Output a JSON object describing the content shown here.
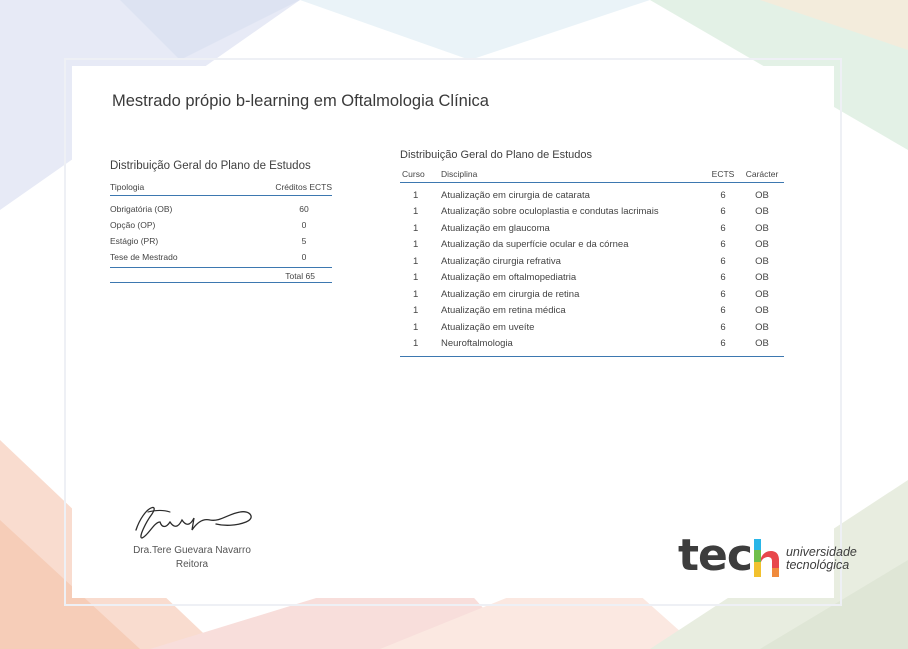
{
  "document": {
    "title": "Mestrado própio b-learning em Oftalmologia Clínica"
  },
  "summary": {
    "title": "Distribuição Geral do Plano de Estudos",
    "headers": {
      "type": "Tipologia",
      "credits": "Créditos ECTS"
    },
    "rows": [
      {
        "type": "Obrigatória (OB)",
        "credits": "60"
      },
      {
        "type": "Opção (OP)",
        "credits": "0"
      },
      {
        "type": "Estágio (PR)",
        "credits": "5"
      },
      {
        "type": "Tese de Mestrado",
        "credits": "0"
      }
    ],
    "total": "Total 65"
  },
  "curriculum": {
    "title": "Distribuição Geral do Plano de Estudos",
    "headers": {
      "course": "Curso",
      "subject": "Disciplina",
      "ects": "ECTS",
      "type": "Carácter"
    },
    "rows": [
      {
        "course": "1",
        "subject": "Atualização em cirurgia de catarata",
        "ects": "6",
        "type": "OB"
      },
      {
        "course": "1",
        "subject": "Atualização sobre oculoplastia e condutas lacrimais",
        "ects": "6",
        "type": "OB"
      },
      {
        "course": "1",
        "subject": "Atualização em glaucoma",
        "ects": "6",
        "type": "OB"
      },
      {
        "course": "1",
        "subject": "Atualização da superfície ocular e da córnea",
        "ects": "6",
        "type": "OB"
      },
      {
        "course": "1",
        "subject": "Atualização cirurgia refrativa",
        "ects": "6",
        "type": "OB"
      },
      {
        "course": "1",
        "subject": "Atualização em oftalmopediatria",
        "ects": "6",
        "type": "OB"
      },
      {
        "course": "1",
        "subject": "Atualização em cirurgia de retina",
        "ects": "6",
        "type": "OB"
      },
      {
        "course": "1",
        "subject": "Atualização em retina médica",
        "ects": "6",
        "type": "OB"
      },
      {
        "course": "1",
        "subject": "Atualização em uveíte",
        "ects": "6",
        "type": "OB"
      },
      {
        "course": "1",
        "subject": "Neuroftalmologia",
        "ects": "6",
        "type": "OB"
      }
    ]
  },
  "signatory": {
    "name": "Dra.Tere Guevara Navarro",
    "role": "Reitora"
  },
  "logo": {
    "word": "tec",
    "subtitle_line1": "universidade",
    "subtitle_line2": "tecnológica"
  },
  "colors": {
    "rule_blue": "#3d78b0",
    "logo_cyan": "#29b6e8",
    "logo_green": "#6fbf4a",
    "logo_yellow": "#f2c12e",
    "logo_orange": "#f08a3c",
    "logo_red": "#e8474b"
  }
}
